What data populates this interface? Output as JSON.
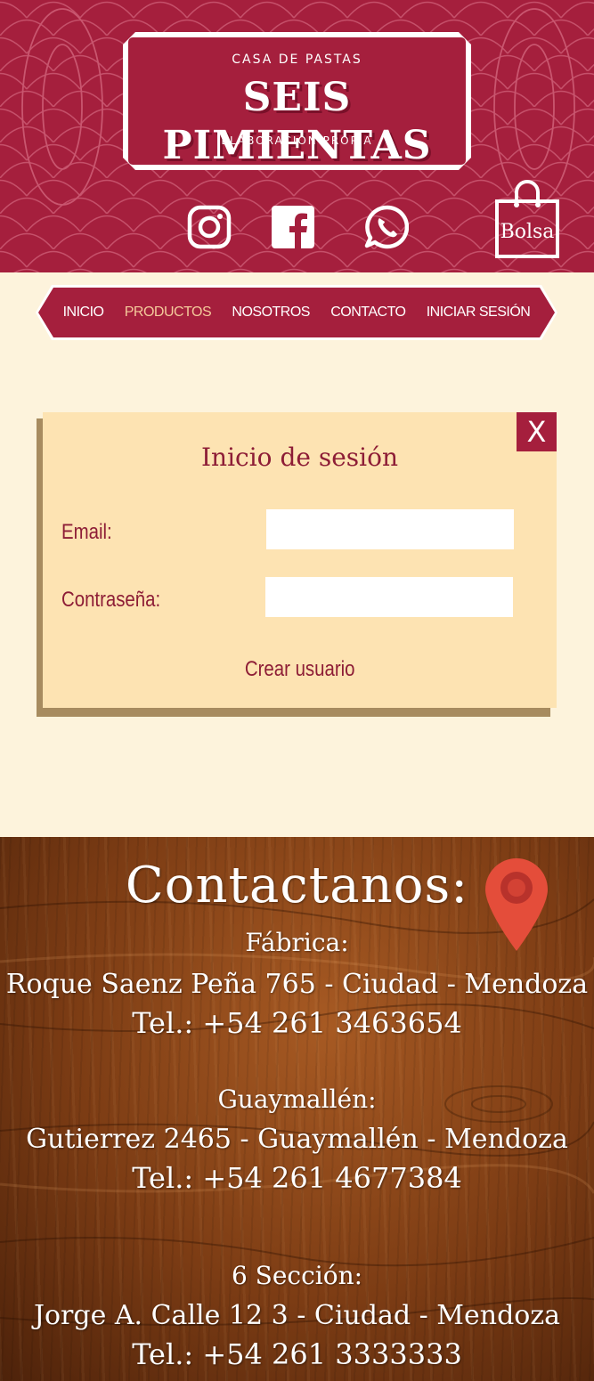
{
  "logo": {
    "top_text": "CASA DE PASTAS",
    "main_text": "SEIS PIMIENTAS",
    "bottom_text": "ELABORACIÓN PROPIA"
  },
  "social": {
    "icons": [
      "instagram-icon",
      "facebook-icon",
      "whatsapp-icon"
    ]
  },
  "bag": {
    "label": "Bolsa",
    "icon": "shopping-bag-icon"
  },
  "nav": {
    "items": [
      {
        "label": "INICIO"
      },
      {
        "label": "PRODUCTOS"
      },
      {
        "label": "NOSOTROS"
      },
      {
        "label": "CONTACTO"
      },
      {
        "label": "INICIAR SESIÓN"
      }
    ]
  },
  "login": {
    "close_label": "X",
    "title": "Inicio de sesión",
    "email_label": "Email:",
    "email_value": "",
    "password_label": "Contraseña:",
    "password_value": "",
    "create_user_label": "Crear usuario"
  },
  "contact": {
    "title": "Contactanos:",
    "pin_icon": "map-pin-icon",
    "locations": [
      {
        "name": "Fábrica:",
        "address": "Roque Saenz Peña 765 - Ciudad - Mendoza",
        "phone": "Tel.: +54 261 3463654"
      },
      {
        "name": "Guaymallén:",
        "address": "Gutierrez 2465 - Guaymallén - Mendoza",
        "phone": "Tel.: +54 261 4677384"
      },
      {
        "name": "6 Sección:",
        "address": "Jorge A. Calle 12 3 - Ciudad - Mendoza",
        "phone": "Tel.: +54 261 3333333"
      }
    ]
  },
  "colors": {
    "brand": "#a51f3d",
    "nav_active": "#f4c99a",
    "page_bg": "#fdf3dc",
    "panel_bg": "#fde3b2",
    "panel_shadow": "#a78b5f",
    "pin": "#e44d3a"
  }
}
